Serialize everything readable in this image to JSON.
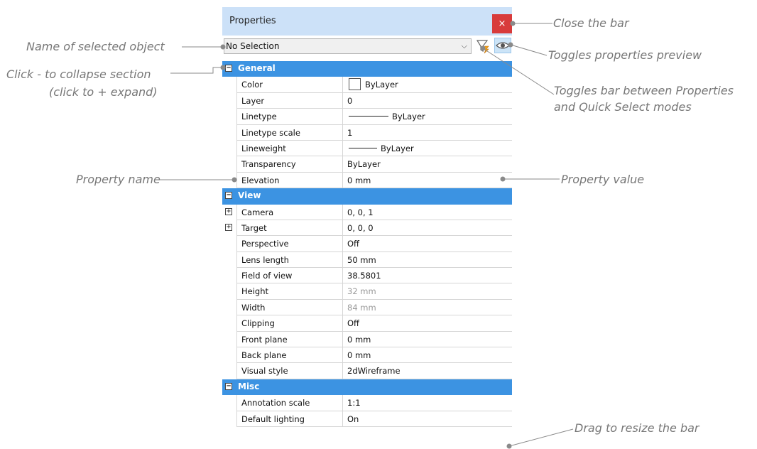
{
  "panel": {
    "title": "Properties",
    "close_glyph": "×",
    "selection": "No Selection",
    "caret_glyph": "⌵",
    "icons": [
      "quick-select-filter-icon",
      "eye-icon",
      "close-icon"
    ]
  },
  "sections": [
    {
      "toggle": "−",
      "label": "General"
    },
    {
      "toggle": "−",
      "label": "View"
    },
    {
      "toggle": "−",
      "label": "Misc"
    }
  ],
  "general": [
    {
      "name": "Color",
      "value": "ByLayer"
    },
    {
      "name": "Layer",
      "value": "0"
    },
    {
      "name": "Linetype",
      "value": "ByLayer"
    },
    {
      "name": "Linetype scale",
      "value": "1"
    },
    {
      "name": "Lineweight",
      "value": "ByLayer"
    },
    {
      "name": "Transparency",
      "value": "ByLayer"
    },
    {
      "name": "Elevation",
      "value": "0 mm"
    }
  ],
  "view": [
    {
      "name": "Camera",
      "value": "0, 0, 1",
      "toggle": "+"
    },
    {
      "name": "Target",
      "value": "0, 0, 0",
      "toggle": "+"
    },
    {
      "name": "Perspective",
      "value": "Off"
    },
    {
      "name": "Lens length",
      "value": "50 mm"
    },
    {
      "name": "Field of view",
      "value": "38.5801"
    },
    {
      "name": "Height",
      "value": "32 mm"
    },
    {
      "name": "Width",
      "value": "84 mm"
    },
    {
      "name": "Clipping",
      "value": "Off"
    },
    {
      "name": "Front plane",
      "value": "0 mm"
    },
    {
      "name": "Back plane",
      "value": "0 mm"
    },
    {
      "name": "Visual style",
      "value": "2dWireframe"
    }
  ],
  "misc": [
    {
      "name": "Annotation scale",
      "value": "1:1"
    },
    {
      "name": "Default lighting",
      "value": "On"
    }
  ],
  "annotations": {
    "close": "Close the bar",
    "selected_object": "Name of selected object",
    "preview": "Toggles properties preview",
    "collapse_1": "Click - to collapse section",
    "collapse_2": "(click to + expand)",
    "qs_1": "Toggles bar between Properties",
    "qs_2": "and Quick Select modes",
    "prop_name": "Property name",
    "prop_value": "Property value",
    "resize": "Drag to resize the bar"
  },
  "colors": {
    "titlebar": "#cce1f8",
    "section": "#3c93e2",
    "close": "#d83b3b",
    "annotation_text": "#777777"
  }
}
